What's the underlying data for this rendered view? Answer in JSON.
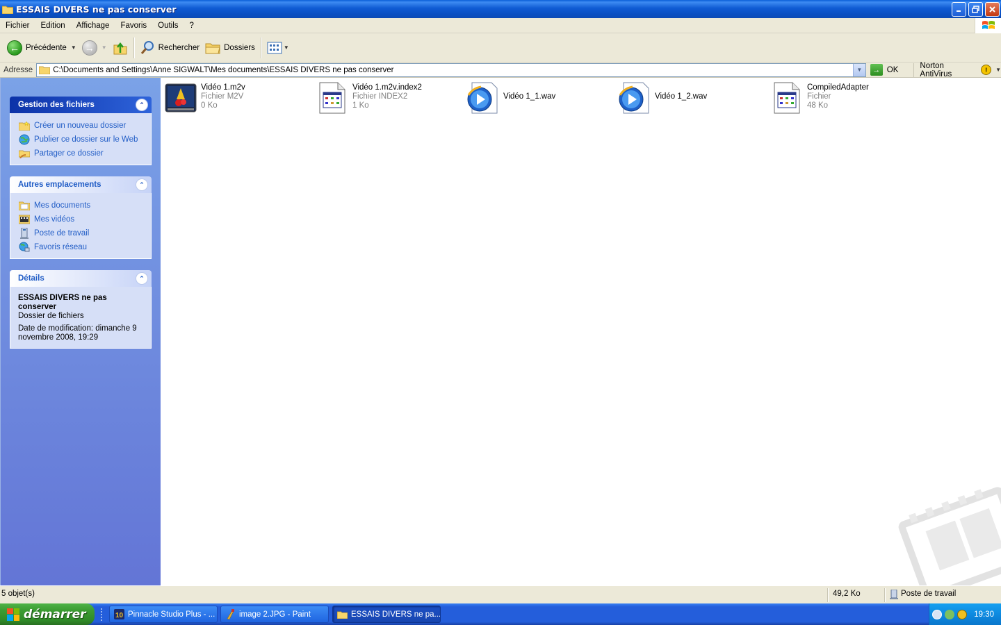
{
  "window": {
    "title": "ESSAIS DIVERS ne pas conserver"
  },
  "menu": [
    "Fichier",
    "Edition",
    "Affichage",
    "Favoris",
    "Outils",
    "?"
  ],
  "toolbar": {
    "back_label": "Précédente",
    "search_label": "Rechercher",
    "folders_label": "Dossiers"
  },
  "address": {
    "label": "Adresse",
    "path": "C:\\Documents and Settings\\Anne SIGWALT\\Mes documents\\ESSAIS DIVERS ne pas conserver",
    "go_label": "OK",
    "norton_label": "Norton AntiVirus"
  },
  "taskpane": {
    "file_tasks": {
      "title": "Gestion des fichiers",
      "items": [
        {
          "label": "Créer un nouveau dossier",
          "icon": "new-folder-icon"
        },
        {
          "label": "Publier ce dossier sur le Web",
          "icon": "publish-web-icon"
        },
        {
          "label": "Partager ce dossier",
          "icon": "share-folder-icon"
        }
      ]
    },
    "other_places": {
      "title": "Autres emplacements",
      "items": [
        {
          "label": "Mes documents",
          "icon": "my-documents-icon"
        },
        {
          "label": "Mes vidéos",
          "icon": "my-videos-icon"
        },
        {
          "label": "Poste de travail",
          "icon": "my-computer-icon"
        },
        {
          "label": "Favoris réseau",
          "icon": "network-places-icon"
        }
      ]
    },
    "details": {
      "title": "Détails",
      "name": "ESSAIS DIVERS ne pas conserver",
      "type": "Dossier de fichiers",
      "modified": "Date de modification: dimanche 9 novembre 2008, 19:29"
    }
  },
  "files": [
    {
      "name": "Vidéo 1.m2v",
      "type": "Fichier M2V",
      "size": "0 Ko",
      "icon": "m2v-video-icon"
    },
    {
      "name": "Vidéo 1.m2v.index2",
      "type": "Fichier INDEX2",
      "size": "1 Ko",
      "icon": "generic-file-icon"
    },
    {
      "name": "Vidéo 1_1.wav",
      "type": "",
      "size": "",
      "icon": "media-player-icon"
    },
    {
      "name": "Vidéo 1_2.wav",
      "type": "",
      "size": "",
      "icon": "media-player-icon"
    },
    {
      "name": "CompiledAdapter",
      "type": "Fichier",
      "size": "48 Ko",
      "icon": "generic-file-icon"
    }
  ],
  "status": {
    "objects": "5 objet(s)",
    "size": "49,2 Ko",
    "location": "Poste de travail"
  },
  "taskbar": {
    "start_label": "démarrer",
    "tasks": [
      {
        "label": "Pinnacle Studio Plus - ...",
        "icon": "pinnacle-icon",
        "active": false
      },
      {
        "label": "image 2.JPG - Paint",
        "icon": "paint-icon",
        "active": false
      },
      {
        "label": "ESSAIS DIVERS ne pa...",
        "icon": "folder-icon",
        "active": true
      }
    ],
    "clock": "19:30"
  }
}
